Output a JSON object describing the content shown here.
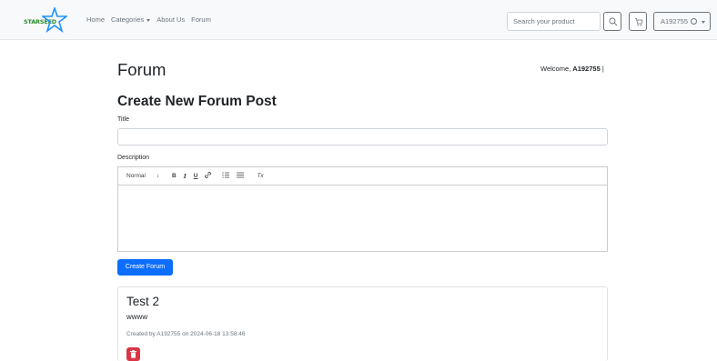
{
  "nav": {
    "brand_text": "STARSEED",
    "links": [
      "Home",
      "Categories",
      "About Us",
      "Forum"
    ],
    "search_placeholder": "Search your product",
    "user_label": "A192755"
  },
  "page": {
    "title": "Forum",
    "welcome_prefix": "Welcome, ",
    "welcome_user": "A192755",
    "welcome_suffix": " |"
  },
  "form": {
    "heading": "Create New Forum Post",
    "title_label": "Title",
    "title_value": "",
    "description_label": "Description",
    "editor_toolbar": {
      "format_select": "Normal",
      "bold": "B",
      "italic": "I",
      "underline": "U",
      "clean": "Tx"
    },
    "submit_label": "Create Forum"
  },
  "posts": [
    {
      "title": "Test 2",
      "body": "wwww",
      "meta": "Created by A192755 on 2024-06-18 13:58:46"
    }
  ],
  "colors": {
    "primary": "#0d6efd",
    "danger": "#dc3545",
    "navbar_bg": "#f8f9fa"
  }
}
